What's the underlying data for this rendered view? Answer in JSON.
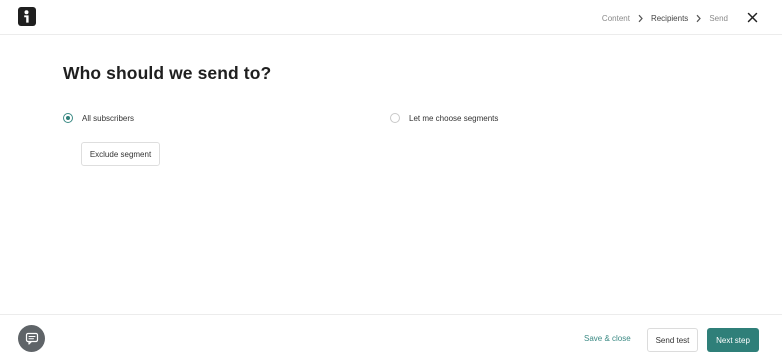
{
  "header": {
    "logo_icon": "brand-logo-icon",
    "breadcrumb": [
      "Content",
      "Recipients",
      "Send"
    ],
    "close_icon": "close-icon"
  },
  "main": {
    "title": "Who should we send to?",
    "options": [
      {
        "label": "All subscribers",
        "selected": true
      },
      {
        "label": "Let me choose segments",
        "selected": false
      }
    ],
    "exclude_label": "Exclude segment"
  },
  "footer": {
    "chat_icon": "chat-icon",
    "save_close_label": "Save & close",
    "send_test_label": "Send test",
    "next_step_label": "Next step"
  },
  "colors": {
    "accent": "#2f7f79",
    "logo": "#1f1f1f",
    "chat_button": "#5f6468"
  }
}
